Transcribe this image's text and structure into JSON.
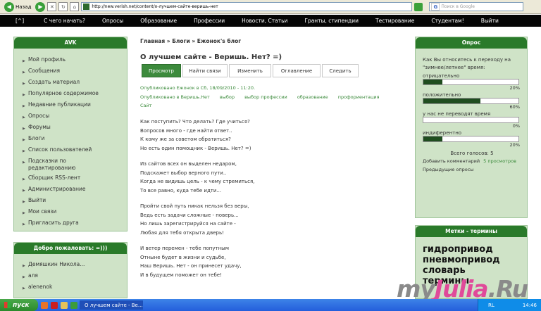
{
  "browser": {
    "back_label": "Назад",
    "url": "http://new.verish.net/content/о-лучшем-сайте-веришь-нет",
    "search_placeholder": "Поиск в Google"
  },
  "nav": {
    "home": "[^]",
    "items": [
      "С чего начать?",
      "Опросы",
      "Образование",
      "Профессии",
      "Новости, Статьи",
      "Гранты, стипендии",
      "Тестирование",
      "Студентам!",
      "Выйти"
    ]
  },
  "sidebar": {
    "title": "AVK",
    "items": [
      "Мой профиль",
      "Сообщения",
      "Создать материал",
      "Популярное содержимое",
      "Недавние публикации",
      "Опросы",
      "Форумы",
      "Блоги",
      "Список пользователей",
      "Подсказки по редактированию",
      "Сборщик RSS-лент",
      "Администрирование",
      "Выйти",
      "Мои связи",
      "Пригласить друга"
    ],
    "welcome_title": "Добро пожаловать: =)))",
    "welcome_users": [
      "Демяшкин Никола...",
      "аля",
      "alenenok"
    ]
  },
  "main": {
    "breadcrumb": "Главная » Блоги » Ежонок's блог",
    "title": "О лучшем сайте - Веришь. Нет? =)",
    "tabs": [
      "Просмотр",
      "Найти связи",
      "Изменить",
      "Оглавление",
      "Следить"
    ],
    "meta": "Опубликовано Ежонок в Сб, 18/09/2010 - 11:20.",
    "tags": [
      "Опубликовано в Веришь.Нет",
      "выбор",
      "выбор профессии",
      "образование",
      "профориентация",
      "Сайт"
    ],
    "stanza1": [
      "Как поступить? Что делать? Где учиться?",
      "Вопросов много - где найти ответ..",
      "К кому же за советом обратиться?",
      "Но есть один помощник - Веришь. Нет? =)"
    ],
    "stanza2": [
      "Из сайтов всех он выделен недаром,",
      "Подскажет выбор верного пути..",
      "Когда не видишь цель - к чему стремиться,",
      "То все равно, куда тебе идти..."
    ],
    "stanza3": [
      "Пройти свой путь никак нельзя без веры,",
      "Ведь есть задачи сложные - поверь...",
      "Но лишь зарегистрируйся на сайте -",
      "Любая для тебя открыта дверь!"
    ],
    "stanza4": [
      "И ветер перемен - тебе попутным",
      "Отныне будет в жизни и судьбе,",
      "Наш Веришь. Нет - он принесет удачу,",
      "И в будущем поможет он тебе!"
    ]
  },
  "poll": {
    "title": "Опрос",
    "question": "Как Вы относитесь к переходу на \"зимнее/летнее\" время:",
    "options": [
      {
        "label": "отрицательно",
        "pct": "20%",
        "value": 20
      },
      {
        "label": "положительно",
        "pct": "60%",
        "value": 60
      },
      {
        "label": "у нас не переводят время",
        "pct": "0%",
        "value": 0
      },
      {
        "label": "индиферентно",
        "pct": "20%",
        "value": 20
      }
    ],
    "total": "Всего голосов: 5",
    "add_comment": "Добавить комментарий",
    "views": "5 просмотров",
    "previous": "Предыдущие опросы"
  },
  "tags_box": {
    "title": "Метки - термины",
    "terms": [
      "гидропривод",
      "пневмопривод",
      "словарь",
      "термины"
    ]
  },
  "taskbar": {
    "start": "пуск",
    "task_label": "О лучшем сайте - Ве...",
    "lang": "RL",
    "time": "14:46"
  },
  "watermark": {
    "left": "my",
    "mid": "Julia",
    "right": ".Ru"
  },
  "colors": {
    "header": "#050505",
    "green": "#2a7a2a",
    "box_bg": "#cfe3c7"
  }
}
